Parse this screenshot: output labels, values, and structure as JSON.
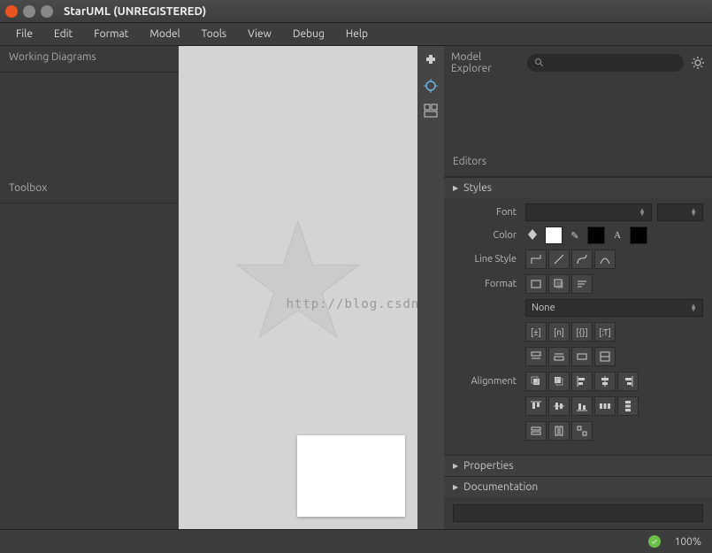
{
  "window": {
    "title": "StarUML (UNREGISTERED)"
  },
  "menubar": [
    "File",
    "Edit",
    "Format",
    "Model",
    "Tools",
    "View",
    "Debug",
    "Help"
  ],
  "left": {
    "working_diagrams": "Working Diagrams",
    "toolbox": "Toolbox"
  },
  "right": {
    "model_explorer": "Model Explorer",
    "search_placeholder": "",
    "editors": "Editors",
    "styles": {
      "header": "Styles",
      "font_label": "Font",
      "font_value": "",
      "font_size": "",
      "color_label": "Color",
      "linestyle_label": "Line Style",
      "format_label": "Format",
      "format_combo": "None",
      "alignment_label": "Alignment"
    },
    "properties": "Properties",
    "documentation": "Documentation"
  },
  "watermark": "http://blog.csdn.net/",
  "status": {
    "zoom": "100%"
  }
}
